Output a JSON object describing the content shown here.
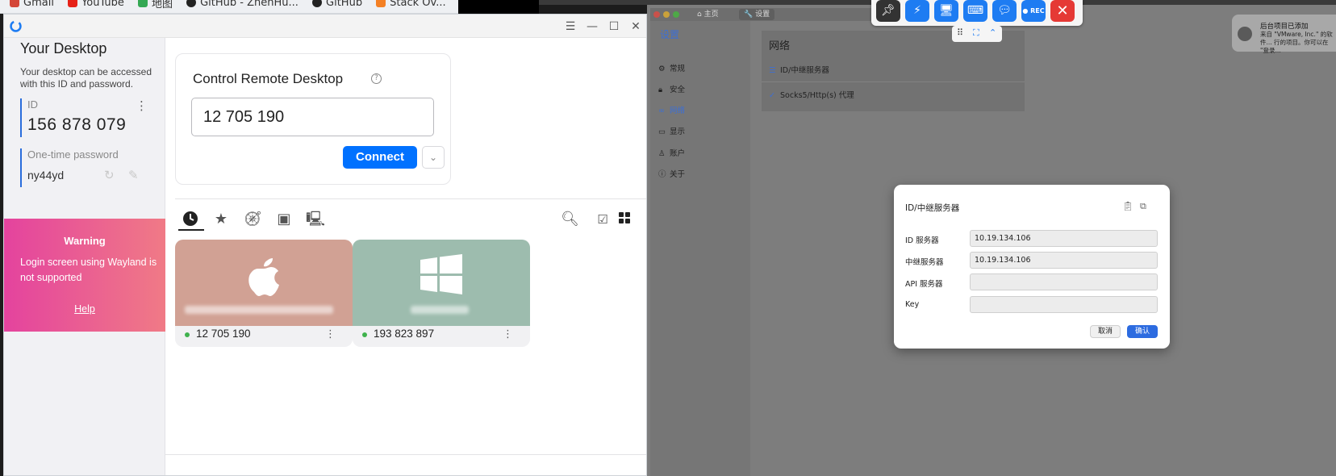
{
  "browser": {
    "bookmarks": [
      {
        "label": "Gmail",
        "color": "#d44638"
      },
      {
        "label": "YouTube",
        "color": "#e62117"
      },
      {
        "label": "地图",
        "color": "#34a853"
      },
      {
        "label": "GitHub - ZhenHu...",
        "color": "#222222"
      },
      {
        "label": "GitHub",
        "color": "#222222"
      },
      {
        "label": "Stack Ov...",
        "color": "#f48024"
      }
    ]
  },
  "rustdesk": {
    "window_icon": "rustdesk-logo-icon",
    "window_controls": {
      "menu": "☰",
      "minimize": "—",
      "maximize": "☐",
      "close": "✕"
    },
    "your_desktop": {
      "title": "Your Desktop",
      "description": "Your desktop can be accessed with this ID and password.",
      "id_label": "ID",
      "id_value": "156 878 079",
      "password_label": "One-time password",
      "password_value": "ny44yd"
    },
    "warning": {
      "title": "Warning",
      "text": "Login screen using Wayland is not supported",
      "help": "Help"
    },
    "control": {
      "title": "Control Remote Desktop",
      "input_value": "12 705 190",
      "connect_label": "Connect"
    },
    "tabs": [
      {
        "name": "recent",
        "icon": "clock-icon"
      },
      {
        "name": "favorites",
        "icon": "star-icon"
      },
      {
        "name": "discovered",
        "icon": "compass-icon"
      },
      {
        "name": "address-book",
        "icon": "contact-icon"
      },
      {
        "name": "group",
        "icon": "devices-icon"
      }
    ],
    "peers": [
      {
        "id": "12 705 190",
        "os": "apple-icon",
        "color": "#d1a194",
        "online": true
      },
      {
        "id": "193 823 897",
        "os": "windows-icon",
        "color": "#9dbcae",
        "online": true
      }
    ]
  },
  "remote": {
    "tabs": [
      {
        "label": "主页",
        "active": false
      },
      {
        "label": "设置",
        "active": true
      }
    ],
    "settings_title": "设置",
    "sidebar": [
      {
        "label": "常规",
        "icon": "gear-icon"
      },
      {
        "label": "安全",
        "icon": "lock-icon"
      },
      {
        "label": "网络",
        "icon": "link-icon",
        "active": true
      },
      {
        "label": "显示",
        "icon": "display-icon"
      },
      {
        "label": "账户",
        "icon": "user-icon"
      },
      {
        "label": "关于",
        "icon": "info-icon"
      }
    ],
    "network": {
      "title": "网络",
      "items": [
        {
          "label": "ID/中继服务器",
          "icon": "server-icon"
        },
        {
          "label": "Socks5/Http(s) 代理",
          "icon": "proxy-icon"
        }
      ]
    },
    "toolbar": {
      "buttons": [
        {
          "name": "pin",
          "icon": "pin-icon",
          "color": "#333333"
        },
        {
          "name": "action",
          "icon": "lightning-icon",
          "color": "#1e7cf2"
        },
        {
          "name": "display",
          "icon": "monitor-icon",
          "color": "#1e7cf2"
        },
        {
          "name": "keyboard",
          "icon": "keyboard-icon",
          "color": "#1e7cf2"
        },
        {
          "name": "chat",
          "icon": "chat-icon",
          "color": "#1e7cf2"
        },
        {
          "name": "record",
          "icon": "record-icon",
          "color": "#1e7cf2",
          "label": "REC"
        },
        {
          "name": "close",
          "icon": "close-icon",
          "color": "#e53935"
        }
      ]
    },
    "notification": {
      "title": "后台项目已添加",
      "body": "来自 \"VMware, Inc.\" 的软件... 行的项目。你可以在 \"登录..."
    },
    "dialog": {
      "title": "ID/中继服务器",
      "fields": [
        {
          "label": "ID 服务器",
          "value": "10.19.134.106"
        },
        {
          "label": "中继服务器",
          "value": "10.19.134.106"
        },
        {
          "label": "API 服务器",
          "value": ""
        },
        {
          "label": "Key",
          "value": ""
        }
      ],
      "cancel": "取消",
      "ok": "确认"
    }
  }
}
